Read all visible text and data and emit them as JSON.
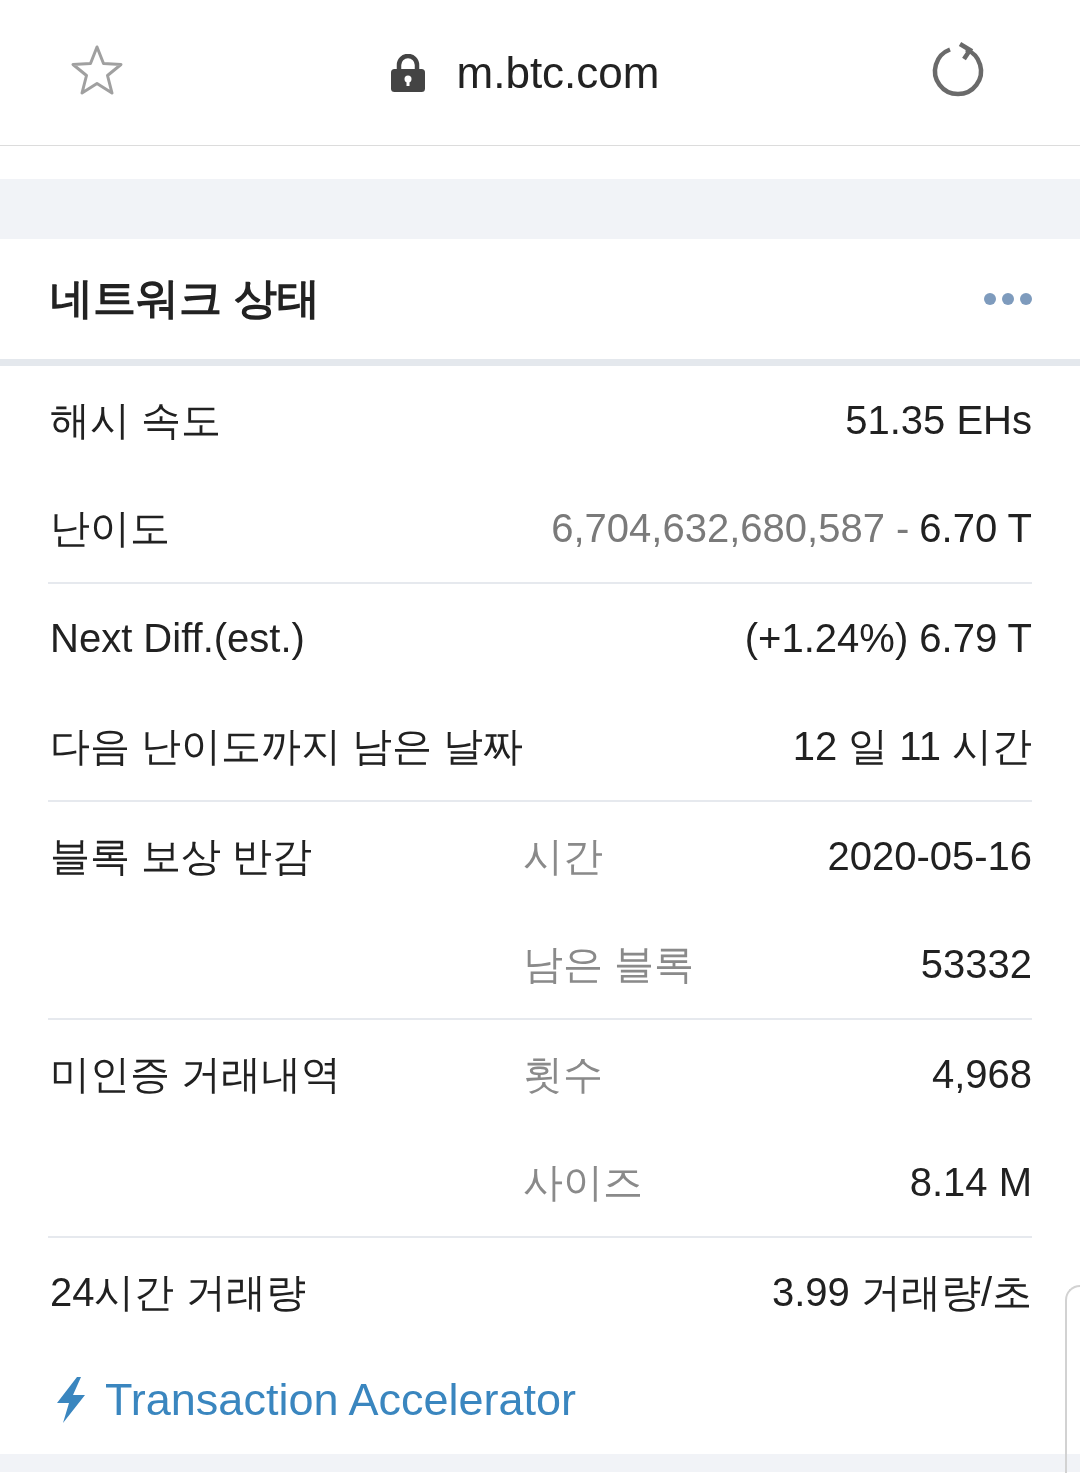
{
  "browser_bar": {
    "url": "m.btc.com"
  },
  "card": {
    "title": "네트워크 상태",
    "groups": [
      {
        "rows": [
          {
            "label": "해시 속도",
            "value": "51.35 EHs"
          },
          {
            "label": "난이도",
            "detail": "6,704,632,680,587 -",
            "value": "6.70 T"
          }
        ]
      },
      {
        "rows": [
          {
            "label": "Next Diff.(est.)",
            "value": "(+1.24%) 6.79 T"
          },
          {
            "label": "다음 난이도까지 남은 날짜",
            "value": "12 일 11 시간"
          }
        ]
      },
      {
        "rows": [
          {
            "label": "블록 보상 반감",
            "sublabel": "시간",
            "value": "2020-05-16"
          },
          {
            "sublabel": "남은 블록",
            "value": "53332"
          }
        ]
      },
      {
        "rows": [
          {
            "label": "미인증 거래내역",
            "sublabel": "횟수",
            "value": "4,968"
          },
          {
            "sublabel": "사이즈",
            "value": "8.14 M"
          }
        ]
      },
      {
        "rows": [
          {
            "label": "24시간 거래량",
            "value": "3.99 거래량/초"
          }
        ]
      }
    ],
    "link": {
      "label": "Transaction Accelerator"
    }
  }
}
